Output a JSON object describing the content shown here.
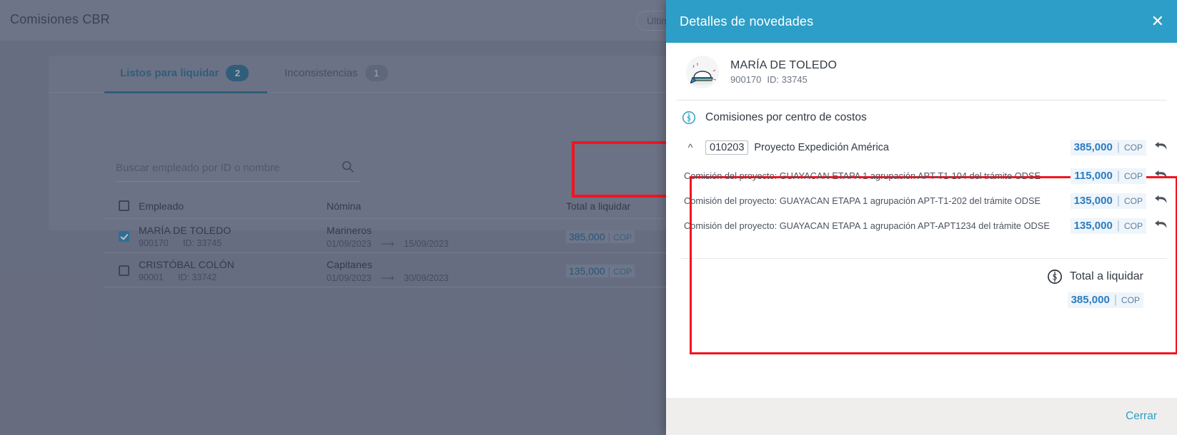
{
  "background": {
    "app_title": "Comisiones CBR",
    "filter_pill": "Últim",
    "tabs": [
      {
        "label": "Listos para liquidar",
        "count": "2",
        "active": true
      },
      {
        "label": "Inconsistencias",
        "count": "1",
        "active": false
      }
    ],
    "search": {
      "placeholder": "Buscar empleado por ID o nombre",
      "value": "",
      "icon": "search-icon"
    },
    "table": {
      "columns": [
        "Empleado",
        "Nómina",
        "Total a liquidar"
      ],
      "rows": [
        {
          "checked": true,
          "name": "MARÍA DE TOLEDO",
          "code": "900170",
          "id": "ID: 33745",
          "payroll": "Marineros",
          "date_from": "01/09/2023",
          "date_to": "15/09/2023",
          "amount": "385,000",
          "currency": "COP"
        },
        {
          "checked": false,
          "name": "CRISTÓBAL COLÓN",
          "code": "90001",
          "id": "ID: 33742",
          "payroll": "Capitanes",
          "date_from": "01/09/2023",
          "date_to": "30/09/2023",
          "amount": "135,000",
          "currency": "COP"
        }
      ]
    }
  },
  "panel": {
    "title": "Detalles de novedades",
    "close_icon": "close-icon",
    "employee": {
      "avatar_icon": "sailor-hat-avatar-icon",
      "name": "MARÍA DE TOLEDO",
      "code": "900170",
      "id": "ID: 33745"
    },
    "section": {
      "icon": "dollar-circle-icon",
      "heading": "Comisiones por centro de costos"
    },
    "cost_center": {
      "expanded": true,
      "chevron_icon": "chevron-up-icon",
      "code": "010203",
      "name": "Proyecto Expedición América",
      "amount": "385,000",
      "currency": "COP",
      "undo_icon": "undo-arrow-icon"
    },
    "items": [
      {
        "description": "Comisión del proyecto: GUAYACAN ETAPA 1 agrupación APT-T1-104 del trámite ODSE",
        "amount": "115,000",
        "currency": "COP",
        "undo_icon": "undo-arrow-icon"
      },
      {
        "description": "Comisión del proyecto: GUAYACAN ETAPA 1 agrupación APT-T1-202 del trámite ODSE",
        "amount": "135,000",
        "currency": "COP",
        "undo_icon": "undo-arrow-icon"
      },
      {
        "description": "Comisión del proyecto: GUAYACAN ETAPA 1 agrupación APT-APT1234 del trámite ODSE",
        "amount": "135,000",
        "currency": "COP",
        "undo_icon": "undo-arrow-icon"
      }
    ],
    "total": {
      "icon": "dollar-circle-icon",
      "label": "Total a liquidar",
      "amount": "385,000",
      "currency": "COP"
    },
    "footer": {
      "close_label": "Cerrar"
    }
  },
  "annotations": {
    "highlight_color": "#f01520",
    "boxes": [
      "total-a-liquidar-column",
      "comisiones-por-centro-de-costos-block"
    ]
  },
  "colors": {
    "panel_header": "#2d9ec7",
    "accent_link": "#2d9ec7",
    "amount_text": "#2b7cc0",
    "tab_active": "#2b6d8e",
    "overlay": "#7d8396"
  }
}
